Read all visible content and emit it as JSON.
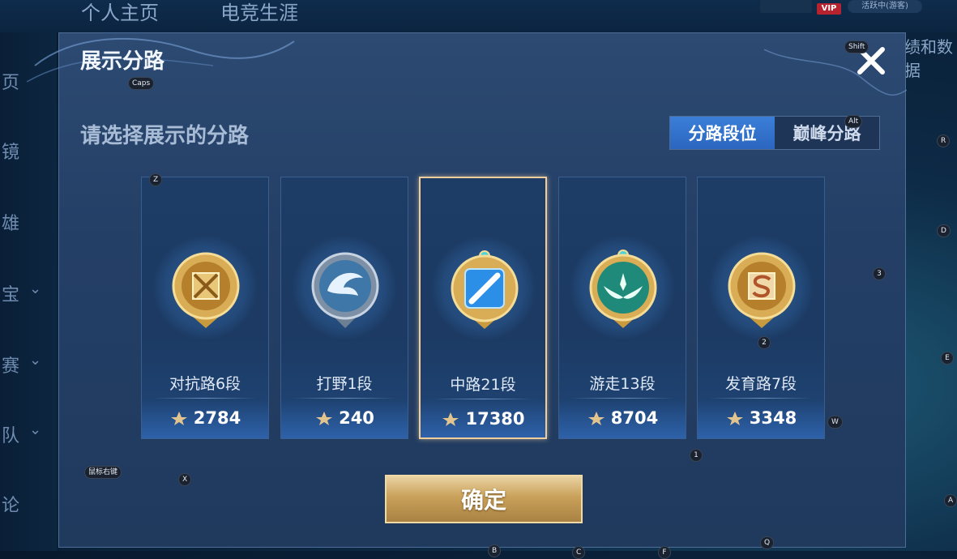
{
  "background": {
    "nav": [
      "个人主页",
      "电竞生涯"
    ],
    "right_text": "绩和数据",
    "side_chars": [
      "页",
      "镜",
      "雄",
      "宝",
      "赛",
      "队",
      "论"
    ],
    "vip": "VIP",
    "status": "活跃中(游客)"
  },
  "dialog": {
    "title": "展示分路",
    "prompt": "请选择展示的分路",
    "tabs": [
      {
        "label": "分路段位",
        "active": true
      },
      {
        "label": "巅峰分路",
        "active": false
      }
    ],
    "cards": [
      {
        "name": "对抗路6段",
        "score": "2784",
        "selected": false,
        "emblem": "clash-lane-emblem"
      },
      {
        "name": "打野1段",
        "score": "240",
        "selected": false,
        "emblem": "jungle-emblem"
      },
      {
        "name": "中路21段",
        "score": "17380",
        "selected": true,
        "emblem": "mid-lane-emblem"
      },
      {
        "name": "游走13段",
        "score": "8704",
        "selected": false,
        "emblem": "roam-emblem"
      },
      {
        "name": "发育路7段",
        "score": "3348",
        "selected": false,
        "emblem": "farm-lane-emblem"
      }
    ],
    "confirm_label": "确定"
  },
  "key_hints": [
    "Caps",
    "Shift",
    "Alt",
    "Z",
    "R",
    "D",
    "3",
    "E",
    "2",
    "W",
    "1",
    "鼠标右键",
    "X",
    "A",
    "Q",
    "B",
    "C",
    "F"
  ],
  "colors": {
    "dialog_bg": "#2c4a72",
    "selected_border": "#f1cd9c",
    "tab_active": "#3b7fd8",
    "confirm_gold": "#c9a15a"
  }
}
